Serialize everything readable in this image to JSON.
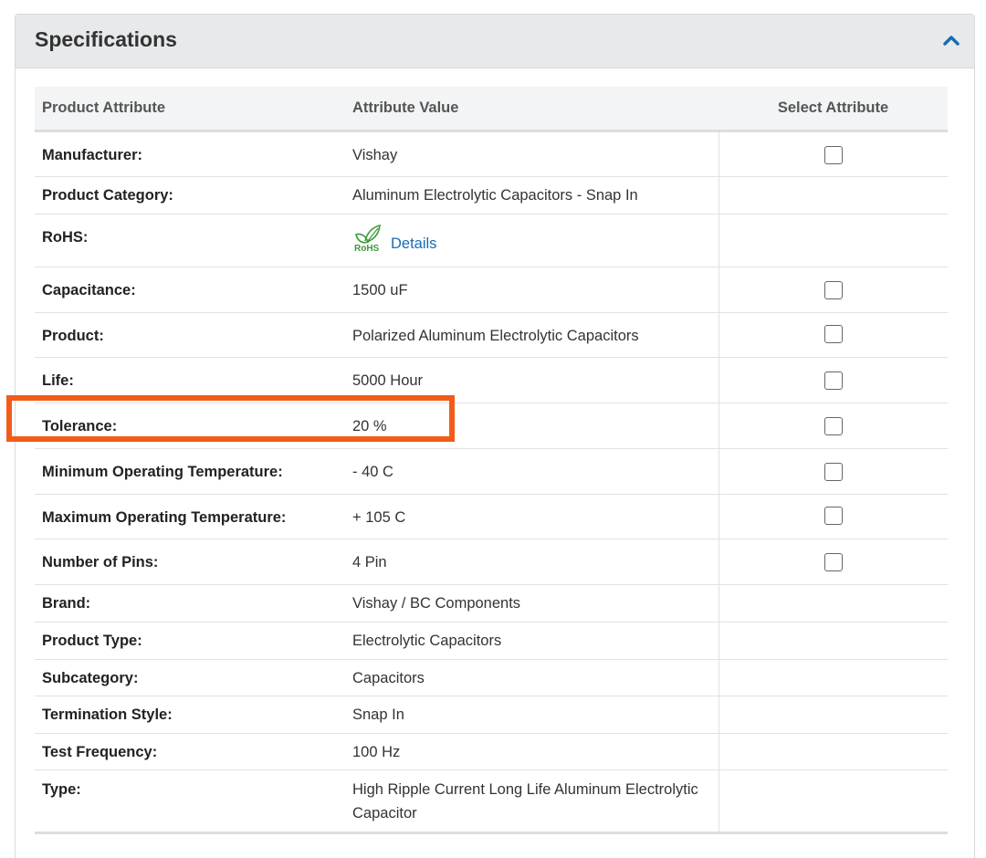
{
  "section": {
    "title": "Specifications"
  },
  "table": {
    "headers": {
      "attribute": "Product Attribute",
      "value": "Attribute Value",
      "select": "Select Attribute"
    },
    "rows": [
      {
        "attr": "Manufacturer:",
        "value": "Vishay",
        "selectable": true
      },
      {
        "attr": "Product Category:",
        "value": "Aluminum Electrolytic Capacitors - Snap In",
        "selectable": false
      },
      {
        "attr": "RoHS:",
        "value": "",
        "link": "Details",
        "logo_text": "RoHS",
        "selectable": false
      },
      {
        "attr": "Capacitance:",
        "value": "1500 uF",
        "selectable": true
      },
      {
        "attr": "Product:",
        "value": "Polarized Aluminum Electrolytic Capacitors",
        "selectable": true
      },
      {
        "attr": "Life:",
        "value": "5000 Hour",
        "selectable": true
      },
      {
        "attr": "Tolerance:",
        "value": "20 %",
        "selectable": true,
        "highlighted": true
      },
      {
        "attr": "Minimum Operating Temperature:",
        "value": "- 40 C",
        "selectable": true
      },
      {
        "attr": "Maximum Operating Temperature:",
        "value": "+ 105 C",
        "selectable": true
      },
      {
        "attr": "Number of Pins:",
        "value": "4 Pin",
        "selectable": true
      },
      {
        "attr": "Brand:",
        "value": "Vishay / BC Components",
        "selectable": false
      },
      {
        "attr": "Product Type:",
        "value": "Electrolytic Capacitors",
        "selectable": false
      },
      {
        "attr": "Subcategory:",
        "value": "Capacitors",
        "selectable": false
      },
      {
        "attr": "Termination Style:",
        "value": "Snap In",
        "selectable": false
      },
      {
        "attr": "Test Frequency:",
        "value": "100 Hz",
        "selectable": false
      },
      {
        "attr": "Type:",
        "value": "High Ripple Current Long Life Aluminum Electrolytic Capacitor",
        "selectable": false
      }
    ]
  },
  "colors": {
    "highlight": "#f25c19",
    "link": "#1a6bb3",
    "rohs_green": "#3d9a3a"
  },
  "icons": {
    "collapse": "chevron-up-icon",
    "rohs": "rohs-leaf-icon"
  }
}
